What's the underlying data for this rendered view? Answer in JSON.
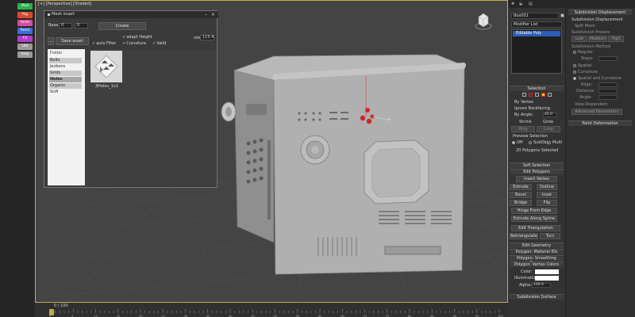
{
  "tool_buttons": [
    {
      "label": "Mod",
      "color": "#2bb24a"
    },
    {
      "label": "Rig",
      "color": "#d84a2d"
    },
    {
      "label": "Anim",
      "color": "#d84aa0"
    },
    {
      "label": "Rend",
      "color": "#3c6fd8"
    },
    {
      "label": "FX",
      "color": "#b43cd0"
    },
    {
      "label": "Util",
      "color": "#9a9a9a"
    },
    {
      "label": "Help",
      "color": "#9a9a9a"
    }
  ],
  "viewport": {
    "label": "[+] [Perspective] [Shaded]",
    "border_color": "#c8a94a"
  },
  "timeline": {
    "frame_label": "0 / 100",
    "ticks": [
      "0",
      "5",
      "10",
      "15",
      "20",
      "25",
      "30",
      "35",
      "40",
      "45",
      "50",
      "55",
      "60",
      "65",
      "70",
      "75",
      "80",
      "85",
      "90",
      "95",
      "100"
    ]
  },
  "dialog": {
    "title": "Mesh insert",
    "base_label": "Base",
    "base_value_a": "0",
    "base_value_b": "0",
    "create_label": "Create",
    "dash_button": "...",
    "save_asset": "Save asset",
    "auto_filter": "auto Filter",
    "adapt_height": "adapt Height",
    "curvature": "Curvature",
    "valid": "Valid",
    "size_label": "size",
    "size_value": "115.4",
    "folder_header": "Folder",
    "folders": [
      "Bolts",
      "buttons",
      "Grids",
      "Holes",
      "Organic",
      "Scifi"
    ],
    "selected_folder": "Holes",
    "thumbnail_label": "3Holes_1x1"
  },
  "right_panel": {
    "object_name": "Box001",
    "modifier_list": "Modifier List",
    "stack_item": "Editable Poly",
    "stack_color": "#2a5fb8",
    "selection_rollout": "Selection",
    "by_vertex": "By Vertex",
    "ignore_backfacing": "Ignore Backfacing",
    "by_angle": "By Angle:",
    "by_angle_value": "45.0",
    "shrink": "Shrink",
    "grow": "Grow",
    "ring": "Ring",
    "loop": "Loop",
    "preview_selection": "Preview Selection",
    "preview_off": "Off",
    "preview_subobj": "SubObj",
    "preview_multi": "Multi",
    "selected_count": "20 Polygons Selected",
    "soft_selection": "Soft Selection",
    "edit_polygons": "Edit Polygons",
    "insert_vertex": "Insert Vertex",
    "extrude": "Extrude",
    "outline": "Outline",
    "bevel": "Bevel",
    "inset": "Inset",
    "bridge": "Bridge",
    "flip": "Flip",
    "hinge": "Hinge From Edge",
    "extrude_spline": "Extrude Along Spline",
    "edit_triangulation": "Edit Triangulation",
    "retriangulate": "Retriangulate",
    "turn": "Turn",
    "edit_geometry": "Edit Geometry",
    "material_ids": "Polygon: Material IDs",
    "smoothing_groups": "Polygon: Smoothing Groups",
    "vertex_colors": "Polygon: Vertex Colors",
    "color_label": "Color:",
    "illumination_label": "Illumination:",
    "alpha_label": "Alpha:",
    "alpha_value": "100.0",
    "subdivision_surface": "Subdivision Surface",
    "subdiv_disp": "Subdivision Displacement",
    "subdiv_disp_check": "Subdivision Displacement",
    "split_mesh": "Split Mesh",
    "subdiv_presets": "Subdivision Presets",
    "low": "Low",
    "medium": "Medium",
    "high": "High",
    "subdiv_method": "Subdivision Method",
    "regular": "Regular",
    "steps": "Steps:",
    "spatial": "Spatial",
    "curvature": "Curvature",
    "spatial_curvature": "Spatial and Curvature",
    "edge": "Edge:",
    "distance": "Distance:",
    "angle": "Angle:",
    "view_dependent": "View-Dependent",
    "advanced_params": "Advanced Parameters",
    "paint_deformation": "Paint Deformation"
  }
}
